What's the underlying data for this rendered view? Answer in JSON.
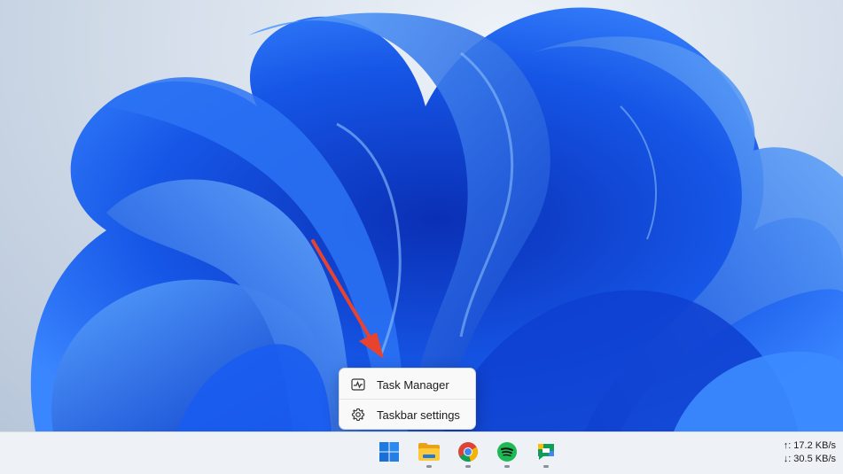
{
  "context_menu": {
    "items": [
      {
        "label": "Task Manager",
        "icon": "task-manager-icon"
      },
      {
        "label": "Taskbar settings",
        "icon": "gear-icon"
      }
    ]
  },
  "taskbar": {
    "apps": [
      {
        "name": "Start",
        "icon": "windows-start-icon",
        "running": false
      },
      {
        "name": "File Explorer",
        "icon": "folder-icon",
        "running": true
      },
      {
        "name": "Google Chrome",
        "icon": "chrome-icon",
        "running": true
      },
      {
        "name": "Spotify",
        "icon": "spotify-icon",
        "running": true
      },
      {
        "name": "Google Chat",
        "icon": "chat-icon",
        "running": true
      }
    ],
    "network": {
      "upload": "↑: 17.2 KB/s",
      "download": "↓: 30.5 KB/s"
    }
  },
  "colors": {
    "wallpaper_blue": "#1f5fe0",
    "arrow_red": "#e8432f",
    "taskbar_bg": "#eef2f7"
  }
}
